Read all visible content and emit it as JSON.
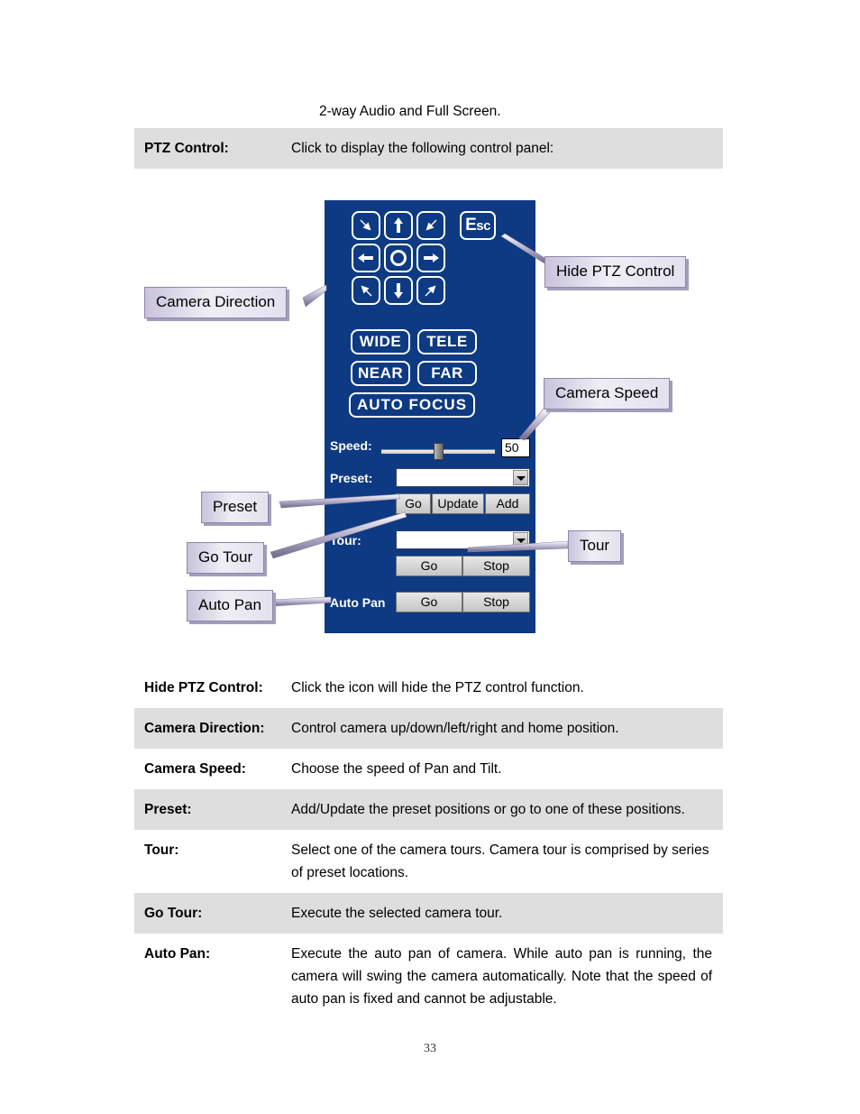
{
  "intro": {
    "text": "2-way Audio and Full Screen."
  },
  "top_table": {
    "rows": [
      {
        "term": "PTZ Control:",
        "desc": "Click to display the following control panel:",
        "shaded": true
      }
    ]
  },
  "ptz_panel": {
    "direction_pad": {
      "buttons": [
        {
          "name": "up-left-arrow",
          "glyph": "↖"
        },
        {
          "name": "up-arrow",
          "glyph": "↑"
        },
        {
          "name": "up-right-arrow",
          "glyph": "↗"
        },
        {
          "name": "left-arrow",
          "glyph": "←"
        },
        {
          "name": "home-circle",
          "glyph": "○"
        },
        {
          "name": "right-arrow",
          "glyph": "→"
        },
        {
          "name": "down-left-arrow",
          "glyph": "↙"
        },
        {
          "name": "down-arrow",
          "glyph": "↓"
        },
        {
          "name": "down-right-arrow",
          "glyph": "↘"
        }
      ]
    },
    "esc_button": {
      "upper": "E",
      "lower": "sc"
    },
    "zoom_buttons": {
      "wide": "WIDE",
      "tele": "TELE",
      "near": "NEAR",
      "far": "FAR",
      "auto_focus": "AUTO FOCUS"
    },
    "speed": {
      "label": "Speed:",
      "value": "50",
      "slider_percent": 50
    },
    "preset": {
      "label": "Preset:",
      "selected": "",
      "go": "Go",
      "update": "Update",
      "add": "Add"
    },
    "tour": {
      "label": "Tour:",
      "selected": "",
      "go": "Go",
      "stop": "Stop"
    },
    "auto_pan": {
      "label": "Auto Pan",
      "go": "Go",
      "stop": "Stop"
    },
    "colors": {
      "panel_blue": "#0d3a82",
      "button_outline": "#ffffff"
    }
  },
  "callouts": {
    "camera_direction": "Camera Direction",
    "hide_ptz_control": "Hide PTZ Control",
    "camera_speed": "Camera Speed",
    "preset": "Preset",
    "go_tour": "Go Tour",
    "auto_pan": "Auto Pan",
    "tour": "Tour",
    "color": "#c9c3dd"
  },
  "bottom_table": {
    "rows": [
      {
        "term": "Hide PTZ Control:",
        "desc": "Click the icon will hide the PTZ control function.",
        "shaded": false
      },
      {
        "term": "Camera Direction:",
        "desc": "Control camera up/down/left/right and home position.",
        "shaded": true
      },
      {
        "term": "Camera Speed:",
        "desc": "Choose the speed of Pan and Tilt.",
        "shaded": false
      },
      {
        "term": "Preset:",
        "desc": "Add/Update the preset positions or go to one of these positions.",
        "shaded": true
      },
      {
        "term": "Tour:",
        "desc": "Select one of the camera tours. Camera tour is comprised by series of preset locations.",
        "shaded": false
      },
      {
        "term": "Go Tour:",
        "desc": "Execute the selected camera tour.",
        "shaded": true
      },
      {
        "term": "Auto Pan:",
        "desc": "Execute the auto pan of camera. While auto pan is running, the camera will swing the camera automatically. Note that the speed of auto pan is fixed and cannot be adjustable.",
        "shaded": false
      }
    ]
  },
  "footer": {
    "page_number": "33"
  }
}
